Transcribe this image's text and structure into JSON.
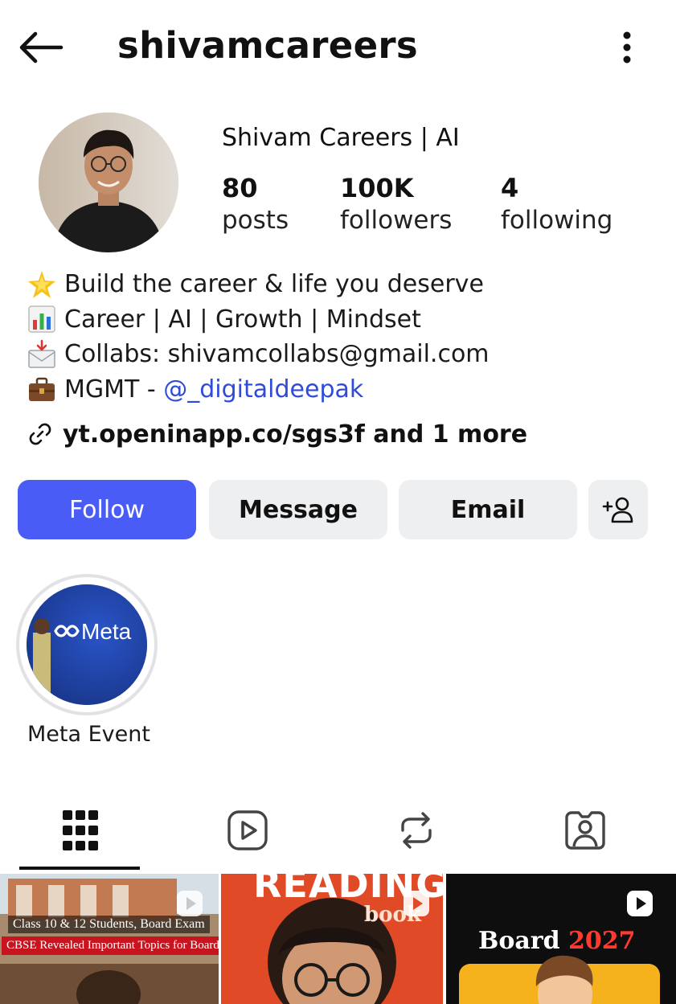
{
  "header": {
    "username": "shivamcareers",
    "back_icon": "arrow-left-icon",
    "more_icon": "more-vertical-icon"
  },
  "profile": {
    "display_name": "Shivam Careers | AI",
    "stats": {
      "posts": {
        "value": "80",
        "label": "posts"
      },
      "followers": {
        "value": "100K",
        "label": "followers"
      },
      "following": {
        "value": "4",
        "label": "following"
      }
    },
    "bio": {
      "line1": "Build the career & life you deserve",
      "line2": "Career | AI | Growth | Mindset",
      "line3": "Collabs: shivamcollabs@gmail.com",
      "line4_prefix": "MGMT - ",
      "line4_mention": "@_digitaldeepak"
    },
    "link": "yt.openinapp.co/sgs3f and 1 more"
  },
  "actions": {
    "follow": "Follow",
    "message": "Message",
    "email": "Email"
  },
  "highlights": [
    {
      "label": "Meta Event",
      "image_text": "Meta"
    }
  ],
  "tabs": [
    "grid-icon",
    "reels-icon",
    "reposts-icon",
    "tagged-icon"
  ],
  "posts": [
    {
      "line1": "Class 10 & 12 Students, Board Exam",
      "line2": "CBSE Revealed Important Topics for Boards!"
    },
    {
      "title": "READING",
      "sub": "book"
    },
    {
      "title_prefix": "Board ",
      "title_year": "2027"
    }
  ],
  "colors": {
    "follow_button": "#4a5cf6",
    "secondary_button": "#eeeff1",
    "mention": "#2f4bd8"
  }
}
